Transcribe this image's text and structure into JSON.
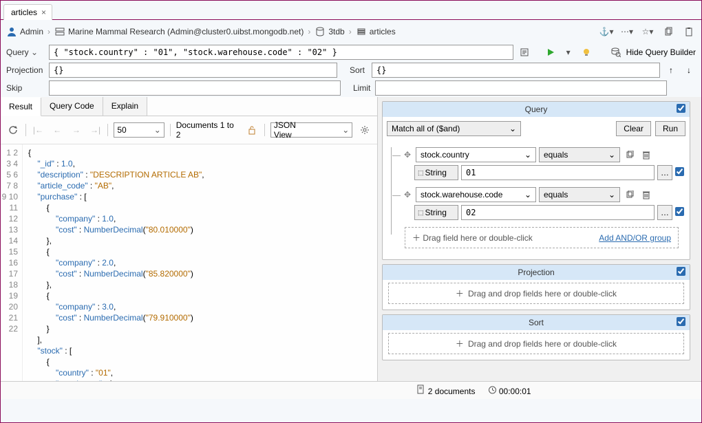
{
  "tab": {
    "title": "articles",
    "close": "×"
  },
  "breadcrumb": {
    "user": "Admin",
    "connection": "Marine Mammal Research (Admin@cluster0.uibst.mongodb.net)",
    "db": "3tdb",
    "coll": "articles"
  },
  "query_bar": {
    "label": "Query",
    "value": "{ \"stock.country\" : \"01\", \"stock.warehouse.code\" : \"02\" }",
    "hide_builder": "Hide Query Builder"
  },
  "projection": {
    "label": "Projection",
    "value": "{}"
  },
  "sort": {
    "label": "Sort",
    "value": "{}"
  },
  "skip": {
    "label": "Skip",
    "value": ""
  },
  "limit": {
    "label": "Limit",
    "value": ""
  },
  "tabs": {
    "result": "Result",
    "query_code": "Query Code",
    "explain": "Explain"
  },
  "toolbar": {
    "page_size": "50",
    "doc_range": "Documents 1 to 2",
    "view_mode": "JSON View"
  },
  "code_lines": [
    "{",
    "    \"_id\" : 1.0,",
    "    \"description\" : \"DESCRIPTION ARTICLE AB\",",
    "    \"article_code\" : \"AB\",",
    "    \"purchase\" : [",
    "        {",
    "            \"company\" : 1.0,",
    "            \"cost\" : NumberDecimal(\"80.010000\")",
    "        },",
    "        {",
    "            \"company\" : 2.0,",
    "            \"cost\" : NumberDecimal(\"85.820000\")",
    "        },",
    "        {",
    "            \"company\" : 3.0,",
    "            \"cost\" : NumberDecimal(\"79.910000\")",
    "        }",
    "    ],",
    "    \"stock\" : [",
    "        {",
    "            \"country\" : \"01\",",
    "            \"warehouse\" : {"
  ],
  "status": {
    "docs": "2 documents",
    "time": "00:00:01"
  },
  "qb": {
    "title": "Query",
    "match": "Match all of ($and)",
    "clear": "Clear",
    "run": "Run",
    "conditions": [
      {
        "field": "stock.country",
        "op": "equals",
        "type": "String",
        "value": "01"
      },
      {
        "field": "stock.warehouse.code",
        "op": "equals",
        "type": "String",
        "value": "02"
      }
    ],
    "drop_hint": "Drag field here or double-click",
    "add_group": "Add AND/OR group"
  },
  "proj_panel": {
    "title": "Projection",
    "hint": "Drag and drop fields here or double-click"
  },
  "sort_panel": {
    "title": "Sort",
    "hint": "Drag and drop fields here or double-click"
  }
}
